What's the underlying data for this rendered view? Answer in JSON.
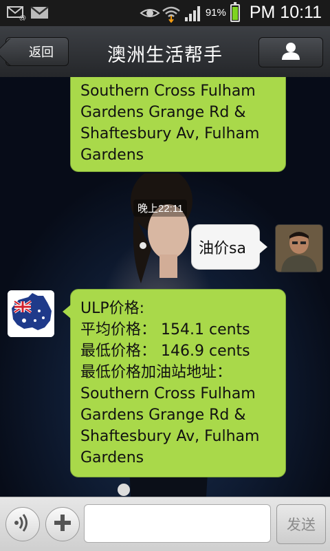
{
  "status_bar": {
    "battery_percent": "91%",
    "time": "PM 10:11",
    "icons": [
      "email-icon",
      "gmail-icon",
      "eye-icon",
      "wifi-icon",
      "signal-icon",
      "battery-icon"
    ]
  },
  "header": {
    "back_label": "返回",
    "title": "澳洲生活帮手",
    "profile_icon": "person-icon"
  },
  "chat": {
    "messages": [
      {
        "sender": "bot",
        "lines": [
          "Southern Cross Fulham",
          "Gardens Grange Rd &",
          "Shaftesbury Av, Fulham",
          "Gardens"
        ]
      },
      {
        "type": "timestamp",
        "text": "晚上22:11"
      },
      {
        "sender": "user",
        "text": "油价sa"
      },
      {
        "sender": "bot",
        "lines": [
          "ULP价格:",
          "平均价格： 154.1 cents",
          "最低价格： 146.9 cents",
          "最低价格加油站地址：",
          "Southern Cross Fulham",
          "Gardens Grange Rd &",
          "Shaftesbury Av, Fulham",
          "Gardens"
        ]
      }
    ]
  },
  "input_bar": {
    "voice_icon": "voice-icon",
    "plus_icon": "plus-icon",
    "input_value": "",
    "send_label": "发送"
  },
  "colors": {
    "bot_bubble": "#a9d94a",
    "user_bubble": "#f5f5f5",
    "header_bg": "#2c2e31"
  }
}
